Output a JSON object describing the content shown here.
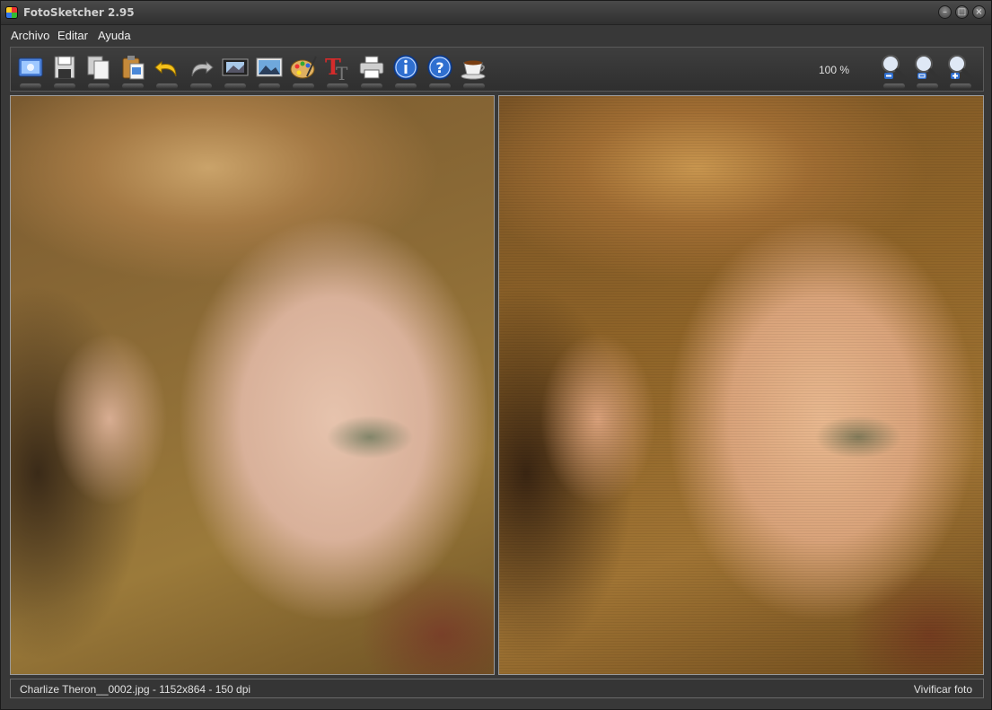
{
  "window": {
    "title": "FotoSketcher 2.95",
    "minimize_icon": "minimize-icon",
    "maximize_icon": "maximize-icon",
    "close_icon": "close-icon"
  },
  "menu": {
    "items": [
      "Archivo",
      "Editar",
      "Ayuda"
    ]
  },
  "toolbar": {
    "buttons": [
      "open-image-icon",
      "save-icon",
      "copy-icon",
      "paste-icon",
      "undo-icon",
      "redo-icon",
      "filmstrip-icon",
      "landscape-image-icon",
      "palette-icon",
      "text-icon",
      "print-icon",
      "info-icon",
      "help-icon",
      "coffee-icon"
    ],
    "zoom_level": "100 %",
    "zoom_buttons": [
      "zoom-out-icon",
      "zoom-fit-icon",
      "zoom-in-icon"
    ]
  },
  "panels": {
    "left": "original-photo",
    "right": "processed-photo"
  },
  "status": {
    "file_info": "Charlize Theron__0002.jpg - 1152x864 - 150 dpi",
    "action": "Vivificar foto"
  }
}
